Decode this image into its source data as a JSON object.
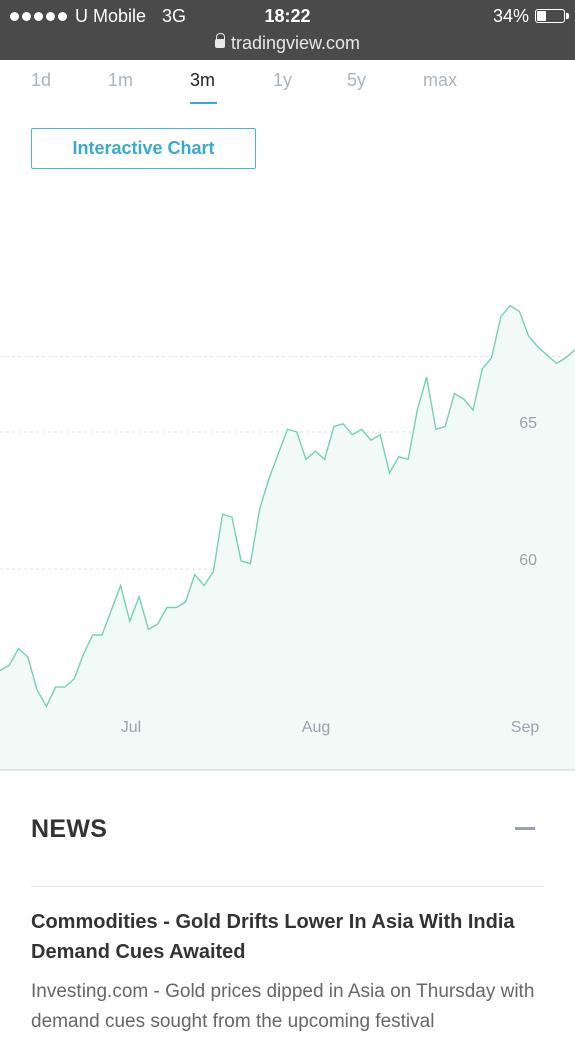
{
  "status_bar": {
    "carrier": "U Mobile",
    "network": "3G",
    "time": "18:22",
    "battery": "34%",
    "battery_level": 0.34,
    "url": "tradingview.com"
  },
  "range_tabs": [
    {
      "label": "1d",
      "active": false
    },
    {
      "label": "1m",
      "active": false
    },
    {
      "label": "3m",
      "active": true
    },
    {
      "label": "1y",
      "active": false
    },
    {
      "label": "5y",
      "active": false
    },
    {
      "label": "max",
      "active": false
    }
  ],
  "interactive_chart_label": "Interactive Chart",
  "chart_data": {
    "type": "area",
    "x_labels": [
      "Jul",
      "Aug",
      "Sep"
    ],
    "y_ticks": [
      60,
      65
    ],
    "ylim": [
      54.5,
      72
    ],
    "grid": true,
    "line_color": "#73d2ae",
    "fill_color": "#f1faf6",
    "grid_color": "#dde3e8",
    "series": [
      {
        "values": [
          56.3,
          56.5,
          57.1,
          56.8,
          55.6,
          55.0,
          55.7,
          55.7,
          56.0,
          56.9,
          57.6,
          57.6,
          58.5,
          59.4,
          58.1,
          59.0,
          57.8,
          58.0,
          58.6,
          58.6,
          58.8,
          59.8,
          59.4,
          59.9,
          62.0,
          61.9,
          60.3,
          60.2,
          62.2,
          63.3,
          64.2,
          65.1,
          65.0,
          64.0,
          64.3,
          64.0,
          65.2,
          65.3,
          64.9,
          65.1,
          64.7,
          64.9,
          63.5,
          64.1,
          64.0,
          65.8,
          67.0,
          65.1,
          65.2,
          66.4,
          66.2,
          65.8,
          67.3,
          67.7,
          69.2,
          69.6,
          69.4,
          68.5,
          68.1,
          67.8,
          67.5,
          67.7,
          68.0
        ]
      }
    ]
  },
  "news": {
    "title": "NEWS",
    "headline": "Commodities - Gold Drifts Lower In Asia With India Demand Cues Awaited",
    "snippet": "Investing.com - Gold prices dipped in Asia on Thursday with demand cues sought from the upcoming festival"
  }
}
